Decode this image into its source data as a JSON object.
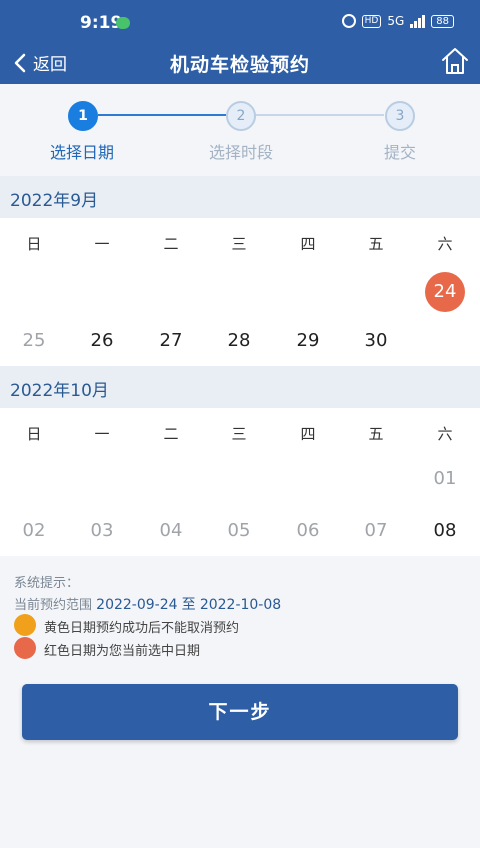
{
  "status_bar": {
    "time": "9:19",
    "network": "5G",
    "hd": "HD",
    "battery": "88"
  },
  "nav": {
    "back_label": "返回",
    "title": "机动车检验预约"
  },
  "steps": [
    {
      "number": "1",
      "label": "选择日期",
      "active": true
    },
    {
      "number": "2",
      "label": "选择时段",
      "active": false
    },
    {
      "number": "3",
      "label": "提交",
      "active": false
    }
  ],
  "weekdays": [
    "日",
    "一",
    "二",
    "三",
    "四",
    "五",
    "六"
  ],
  "months": [
    {
      "title": "2022年9月",
      "rows": [
        [
          null,
          null,
          null,
          null,
          null,
          null,
          {
            "d": "24",
            "state": "selected"
          }
        ],
        [
          {
            "d": "25",
            "state": "disabled"
          },
          {
            "d": "26",
            "state": "available"
          },
          {
            "d": "27",
            "state": "available"
          },
          {
            "d": "28",
            "state": "available"
          },
          {
            "d": "29",
            "state": "available"
          },
          {
            "d": "30",
            "state": "available"
          },
          null
        ]
      ]
    },
    {
      "title": "2022年10月",
      "rows": [
        [
          null,
          null,
          null,
          null,
          null,
          null,
          {
            "d": "01",
            "state": "disabled"
          }
        ],
        [
          {
            "d": "02",
            "state": "disabled"
          },
          {
            "d": "03",
            "state": "disabled"
          },
          {
            "d": "04",
            "state": "disabled"
          },
          {
            "d": "05",
            "state": "disabled"
          },
          {
            "d": "06",
            "state": "disabled"
          },
          {
            "d": "07",
            "state": "disabled"
          },
          {
            "d": "08",
            "state": "available"
          }
        ]
      ]
    }
  ],
  "notes": {
    "heading": "系统提示：",
    "range_prefix": "当前预约范围",
    "range_start": "2022-09-24",
    "range_sep": "至",
    "range_end": "2022-10-08",
    "legend_yellow": "黄色日期预约成功后不能取消预约",
    "legend_red": "红色日期为您当前选中日期"
  },
  "colors": {
    "primary": "#2e5fa6",
    "step_active": "#1a7de0",
    "selected": "#e8684a",
    "yellow": "#f0a01a"
  },
  "next_button": "下一步"
}
